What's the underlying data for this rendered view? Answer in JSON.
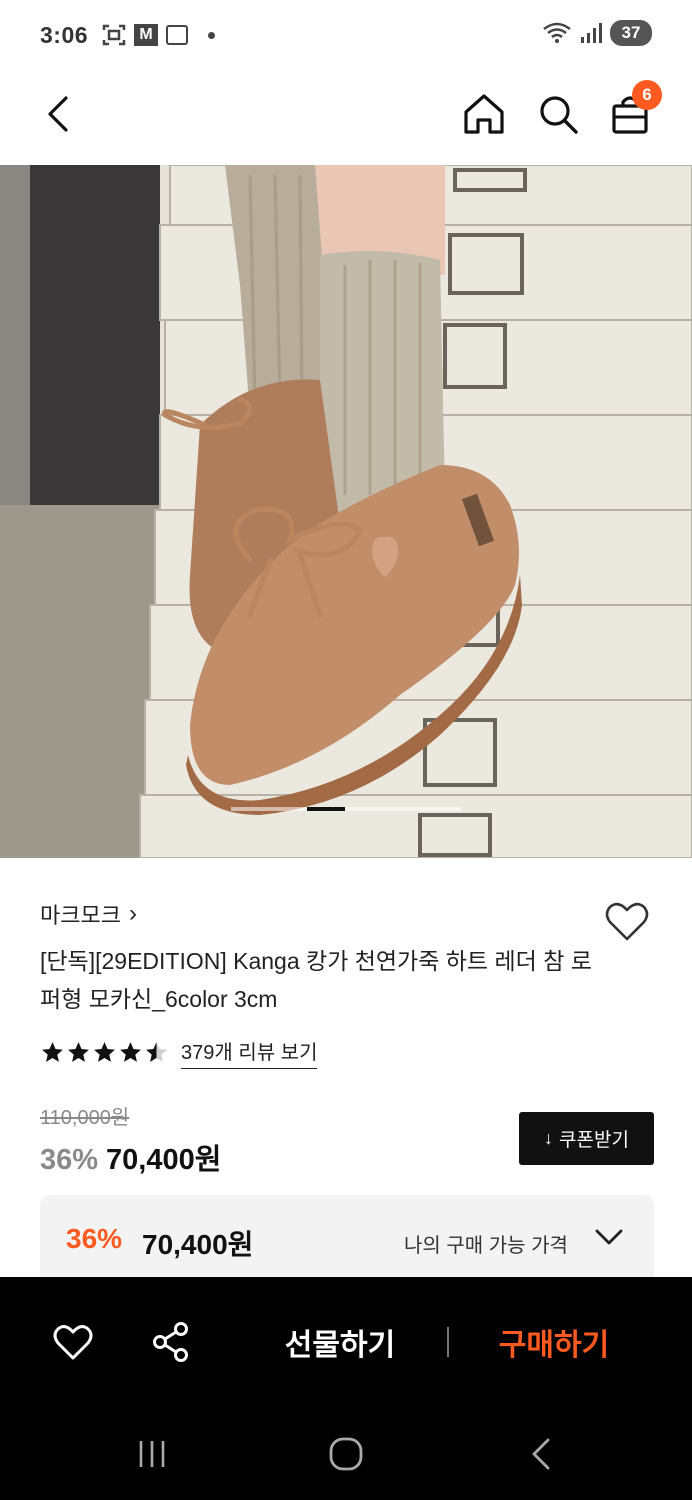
{
  "status_bar": {
    "time": "3:06",
    "m_icon_label": "M",
    "battery": "37"
  },
  "header": {
    "cart_count": "6"
  },
  "image": {
    "carousel_position": 0.33
  },
  "product": {
    "brand": "마크모크",
    "brand_arrow": "›",
    "title": "[단독][29EDITION] Kanga 캉가 천연가죽 하트 레더 참 로퍼형 모카신_6color 3cm",
    "rating": 4.5,
    "review_link": "379개 리뷰 보기",
    "original_price": "110,000원",
    "discount": "36%",
    "price": "70,400원",
    "coupon_label": "쿠폰받기",
    "coupon_icon": "↓"
  },
  "my_price": {
    "discount": "36%",
    "price": "70,400원",
    "label": "나의 구매 가능 가격"
  },
  "action_bar": {
    "gift_label": "선물하기",
    "buy_label": "구매하기"
  },
  "colors": {
    "accent": "#ff5a1f",
    "dark": "#111111",
    "action_bar_bg": "#000000",
    "box_bg": "#f3f3f3"
  }
}
